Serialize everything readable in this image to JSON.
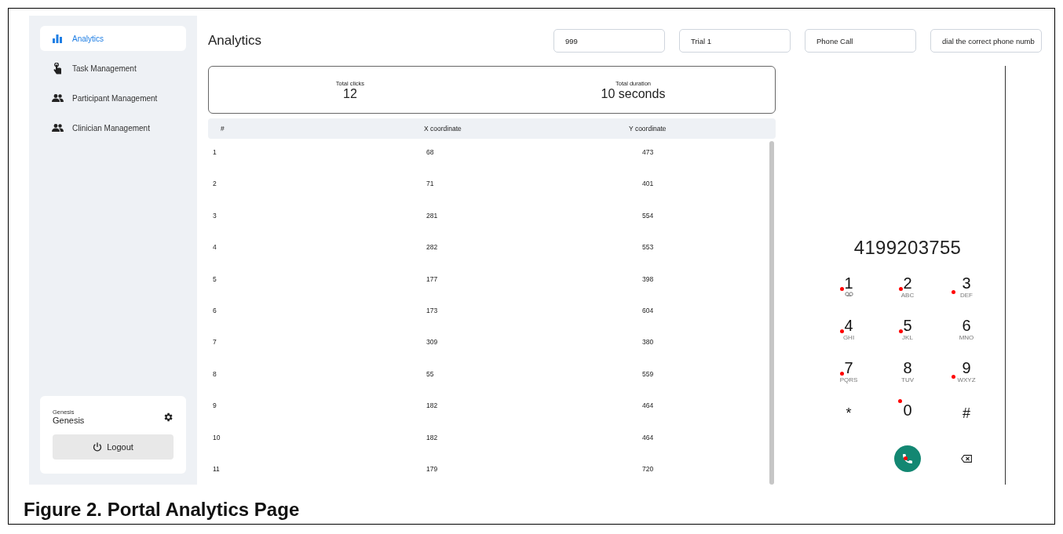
{
  "sidebar": {
    "items": [
      {
        "label": "Analytics",
        "kind": "chart",
        "selected": true
      },
      {
        "label": "Task Management",
        "kind": "hand",
        "selected": false
      },
      {
        "label": "Participant Management",
        "kind": "people",
        "selected": false
      },
      {
        "label": "Clinician Management",
        "kind": "people",
        "selected": false
      }
    ],
    "user": {
      "caption": "Genesis",
      "name": "Genesis",
      "logout": "Logout"
    }
  },
  "header": {
    "title": "Analytics",
    "fields": [
      "999",
      "Trial 1",
      "Phone Call",
      "dial the correct phone numb"
    ]
  },
  "stats": [
    {
      "label": "Total clicks",
      "value": "12"
    },
    {
      "label": "Total duration",
      "value": "10 seconds"
    }
  ],
  "table": {
    "columns": [
      "#",
      "X coordinate",
      "Y coordinate"
    ],
    "rows": [
      [
        "1",
        "68",
        "473"
      ],
      [
        "2",
        "71",
        "401"
      ],
      [
        "3",
        "281",
        "554"
      ],
      [
        "4",
        "282",
        "553"
      ],
      [
        "5",
        "177",
        "398"
      ],
      [
        "6",
        "173",
        "604"
      ],
      [
        "7",
        "309",
        "380"
      ],
      [
        "8",
        "55",
        "559"
      ],
      [
        "9",
        "182",
        "464"
      ],
      [
        "10",
        "182",
        "464"
      ],
      [
        "11",
        "179",
        "720"
      ]
    ]
  },
  "phone": {
    "number": "4199203755",
    "keys": [
      {
        "digit": "1",
        "kind": "voicemail",
        "clicked": true
      },
      {
        "digit": "2",
        "kind": "letters",
        "letters": "ABC",
        "clicked": true
      },
      {
        "digit": "3",
        "kind": "letters",
        "letters": "DEF",
        "clicked": true
      },
      {
        "digit": "4",
        "kind": "letters",
        "letters": "GHI",
        "clicked": true
      },
      {
        "digit": "5",
        "kind": "letters",
        "letters": "JKL",
        "clicked": true
      },
      {
        "digit": "6",
        "kind": "letters",
        "letters": "MNO",
        "clicked": false
      },
      {
        "digit": "7",
        "kind": "letters",
        "letters": "PQRS",
        "clicked": true
      },
      {
        "digit": "8",
        "kind": "letters",
        "letters": "TUV",
        "clicked": false
      },
      {
        "digit": "9",
        "kind": "letters",
        "letters": "WXYZ",
        "clicked": true
      },
      {
        "digit": "*",
        "kind": "symbol",
        "clicked": false
      },
      {
        "digit": "0",
        "kind": "digit",
        "clicked": true
      },
      {
        "digit": "#",
        "kind": "symbol",
        "clicked": false
      }
    ],
    "call_clicked": true
  },
  "caption": "Figure 2. Portal Analytics Page"
}
